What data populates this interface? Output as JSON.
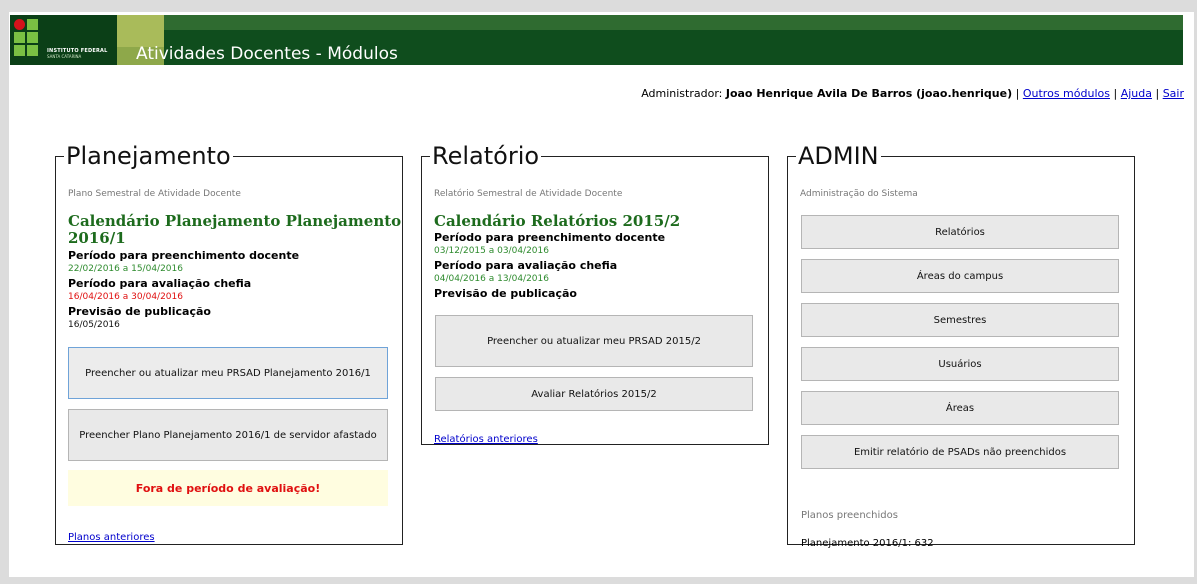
{
  "header": {
    "title": "Atividades Docentes - Módulos",
    "logo_line1": "INSTITUTO FEDERAL",
    "logo_line2": "SANTA CATARINA"
  },
  "userbar": {
    "prefix": "Administrador:",
    "user": "Joao Henrique Avila De Barros (joao.henrique)",
    "sep": "|",
    "outros_modulos": "Outros módulos",
    "ajuda": "Ajuda",
    "sair": "Sair"
  },
  "planejamento": {
    "legend": "Planejamento",
    "subtitle": "Plano Semestral de Atividade Docente",
    "calendar_title_line1": "Calendário Planejamento Planejamento",
    "calendar_title_line2": "2016/1",
    "periodo_docente_label": "Período para preenchimento docente",
    "periodo_docente_dates": "22/02/2016 a 15/04/2016",
    "periodo_chefia_label": "Período para avaliação chefia",
    "periodo_chefia_dates": "16/04/2016 a 30/04/2016",
    "previsao_label": "Previsão de publicação",
    "previsao_date": "16/05/2016",
    "btn_preencher": "Preencher ou atualizar meu PRSAD Planejamento 2016/1",
    "btn_afastado": "Preencher Plano Planejamento 2016/1 de servidor afastado",
    "warning": "Fora de período de avaliação!",
    "link_anteriores": "Planos anteriores"
  },
  "relatorio": {
    "legend": "Relatório",
    "subtitle": "Relatório Semestral de Atividade Docente",
    "calendar_title": "Calendário Relatórios 2015/2",
    "periodo_docente_label": "Período para preenchimento docente",
    "periodo_docente_dates": "03/12/2015 a 03/04/2016",
    "periodo_chefia_label": "Período para avaliação chefia",
    "periodo_chefia_dates": "04/04/2016 a 13/04/2016",
    "previsao_label": "Previsão de publicação",
    "btn_preencher": "Preencher ou atualizar meu PRSAD 2015/2",
    "btn_avaliar": "Avaliar Relatórios 2015/2",
    "link_anteriores": "Relatórios anteriores"
  },
  "admin": {
    "legend": "ADMIN",
    "subtitle": "Administração do Sistema",
    "buttons": [
      "Relatórios",
      "Áreas do campus",
      "Semestres",
      "Usuários",
      "Áreas",
      "Emitir relatório de PSADs não preenchidos"
    ],
    "planos_label": "Planos preenchidos",
    "planos_value": "Planejamento 2016/1: 632"
  },
  "colors": {
    "header_bg": "#0f4d1d",
    "calendar_title": "#1d6b1d",
    "date_green": "#2e8b2e",
    "date_red": "#e01010",
    "link": "#0000cc"
  }
}
